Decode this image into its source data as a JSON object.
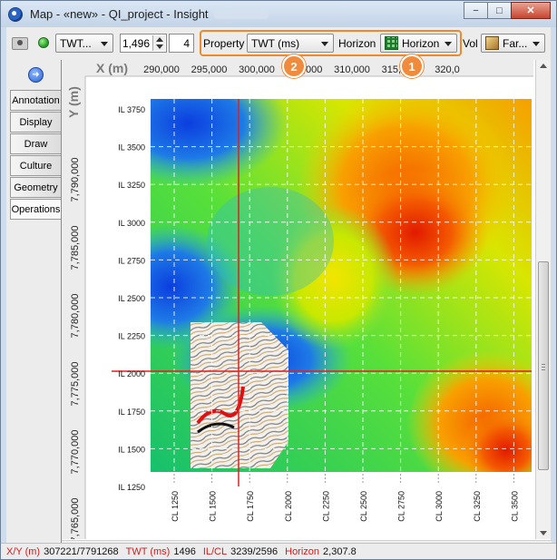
{
  "window": {
    "title": "Map - «new» - QI_project - Insight",
    "controls": {
      "minimize": "−",
      "maximize": "□",
      "close": "✕"
    }
  },
  "toolbar": {
    "twt_combo": "TWT...",
    "spin_value": "1,496",
    "step_value": "4",
    "property_label": "Property",
    "property_value": "TWT (ms)",
    "horizon_label": "Horizon",
    "horizon_value": "Horizon",
    "vol_label": "Vol",
    "vol_value": "Far..."
  },
  "callouts": {
    "one": "1",
    "two": "2"
  },
  "side_tabs": [
    "Annotation",
    "Display",
    "Draw",
    "Culture",
    "Geometry",
    "Operations"
  ],
  "axes": {
    "x_title": "X (m)",
    "y_title": "Y (m)",
    "x_ticks": [
      "290,000",
      "295,000",
      "300,000",
      "305,000",
      "310,000",
      "315,000",
      "320,0"
    ],
    "y_ticks": [
      "7,790,000",
      "7,785,000",
      "7,780,000",
      "7,775,000",
      "7,770,000",
      "7,765,000"
    ],
    "il_labels": [
      "IL 3750",
      "IL 3500",
      "IL 3250",
      "IL 3000",
      "IL 2750",
      "IL 2500",
      "IL 2250",
      "IL 2000",
      "IL 1750",
      "IL 1500",
      "IL 1250"
    ],
    "cl_labels": [
      "CL 1250",
      "CL 1500",
      "CL 1750",
      "CL 2000",
      "CL 2250",
      "CL 2500",
      "CL 2750",
      "CL 3000",
      "CL 3250",
      "CL 3500"
    ]
  },
  "status": {
    "xy_label": "X/Y (m)",
    "xy_value": "307221/7791268",
    "twt_label": "TWT (ms)",
    "twt_value": "1496",
    "ilcl_label": "IL/CL",
    "ilcl_value": "3239/2596",
    "horizon_label": "Horizon",
    "horizon_value": "2,307.8"
  },
  "colors": {
    "highlight": "#ee8a2a",
    "crosshair": "#e02020",
    "status_label": "#d21b1b"
  }
}
